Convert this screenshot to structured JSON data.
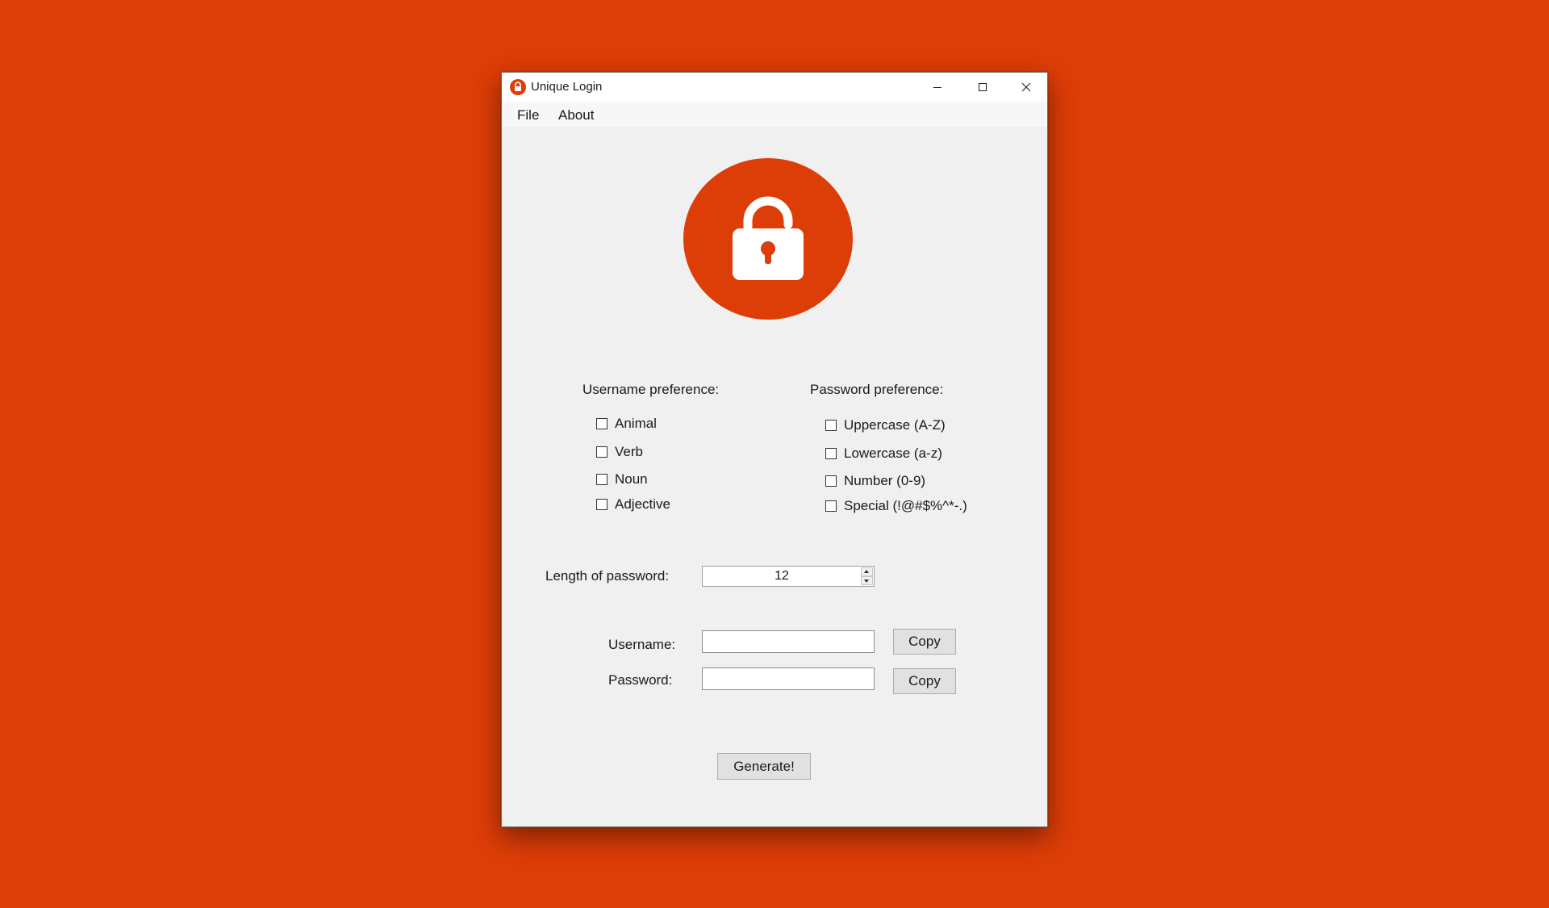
{
  "window": {
    "title": "Unique Login",
    "app_icon": "lock-icon",
    "controls": [
      "minimize-icon",
      "maximize-icon",
      "close-icon"
    ]
  },
  "menubar": {
    "file": "File",
    "about": "About"
  },
  "logo": {
    "icon": "padlock-icon",
    "color": "#dd3d07"
  },
  "username_preference": {
    "heading": "Username preference:",
    "options": [
      {
        "label": "Animal",
        "checked": false
      },
      {
        "label": "Verb",
        "checked": false
      },
      {
        "label": "Noun",
        "checked": false
      },
      {
        "label": "Adjective",
        "checked": false
      }
    ]
  },
  "password_preference": {
    "heading": "Password preference:",
    "options": [
      {
        "label": "Uppercase (A-Z)",
        "checked": false
      },
      {
        "label": "Lowercase (a-z)",
        "checked": false
      },
      {
        "label": "Number (0-9)",
        "checked": false
      },
      {
        "label": "Special (!@#$%^*-.)",
        "checked": false
      }
    ]
  },
  "length": {
    "label": "Length of password:",
    "value": "12"
  },
  "username": {
    "label": "Username:",
    "value": "",
    "copy_label": "Copy"
  },
  "password": {
    "label": "Password:",
    "value": "",
    "copy_label": "Copy"
  },
  "generate_label": "Generate!",
  "colors": {
    "accent": "#dd3d07",
    "window_bg": "#f0f0f0"
  }
}
